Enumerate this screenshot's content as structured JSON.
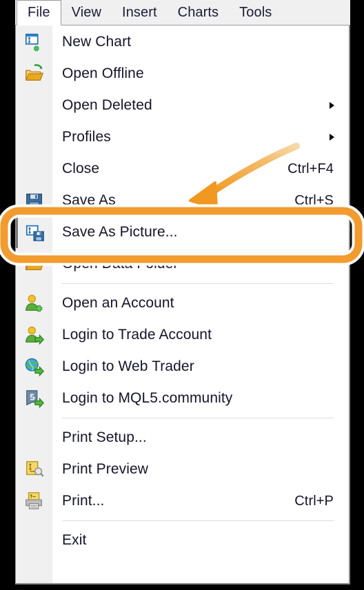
{
  "menubar": {
    "items": [
      {
        "label": "File",
        "active": true
      },
      {
        "label": "View",
        "active": false
      },
      {
        "label": "Insert",
        "active": false
      },
      {
        "label": "Charts",
        "active": false
      },
      {
        "label": "Tools",
        "active": false
      }
    ]
  },
  "menu": {
    "items": [
      {
        "label": "New Chart",
        "icon": "new-chart-icon",
        "shortcut": "",
        "submenu": false,
        "highlight": false,
        "separator_after": false
      },
      {
        "label": "Open Offline",
        "icon": "open-folder-refresh-icon",
        "shortcut": "",
        "submenu": false,
        "highlight": false,
        "separator_after": false
      },
      {
        "label": "Open Deleted",
        "icon": "",
        "shortcut": "",
        "submenu": true,
        "highlight": false,
        "separator_after": false
      },
      {
        "label": "Profiles",
        "icon": "",
        "shortcut": "",
        "submenu": true,
        "highlight": false,
        "separator_after": false
      },
      {
        "label": "Close",
        "icon": "",
        "shortcut": "Ctrl+F4",
        "submenu": false,
        "highlight": false,
        "separator_after": false
      },
      {
        "label": "Save As",
        "icon": "floppy-disk-icon",
        "shortcut": "Ctrl+S",
        "submenu": false,
        "highlight": false,
        "separator_after": false
      },
      {
        "label": "Save As Picture...",
        "icon": "save-as-picture-icon",
        "shortcut": "",
        "submenu": false,
        "highlight": true,
        "separator_after": false
      },
      {
        "label": "Open Data Folder",
        "icon": "open-folder-icon",
        "shortcut": "",
        "submenu": false,
        "highlight": false,
        "separator_after": true
      },
      {
        "label": "Open an Account",
        "icon": "account-add-icon",
        "shortcut": "",
        "submenu": false,
        "highlight": false,
        "separator_after": false
      },
      {
        "label": "Login to Trade Account",
        "icon": "account-login-icon",
        "shortcut": "",
        "submenu": false,
        "highlight": false,
        "separator_after": false
      },
      {
        "label": "Login to Web Trader",
        "icon": "globe-login-icon",
        "shortcut": "",
        "submenu": false,
        "highlight": false,
        "separator_after": false
      },
      {
        "label": "Login to MQL5.community",
        "icon": "mql5-login-icon",
        "shortcut": "",
        "submenu": false,
        "highlight": false,
        "separator_after": true
      },
      {
        "label": "Print Setup...",
        "icon": "",
        "shortcut": "",
        "submenu": false,
        "highlight": false,
        "separator_after": false
      },
      {
        "label": "Print Preview",
        "icon": "print-preview-icon",
        "shortcut": "",
        "submenu": false,
        "highlight": false,
        "separator_after": false
      },
      {
        "label": "Print...",
        "icon": "printer-icon",
        "shortcut": "Ctrl+P",
        "submenu": false,
        "highlight": false,
        "separator_after": true
      },
      {
        "label": "Exit",
        "icon": "",
        "shortcut": "",
        "submenu": false,
        "highlight": false,
        "separator_after": false
      }
    ]
  },
  "annotation": {
    "highlight_target": "Save As Picture...",
    "arrow_direction": "down-left",
    "colors": {
      "accent": "#F29B2E",
      "accent_light": "#F5BE6B",
      "outline": "#FFFFFF"
    }
  },
  "colors": {
    "background": "#000000",
    "menu_background": "#FFFFFF",
    "gutter": "#F0F0F0",
    "menubar": "#F0F0F0",
    "text": "#14142B",
    "border": "#9A9A9A",
    "separator": "#DCDCDC"
  }
}
